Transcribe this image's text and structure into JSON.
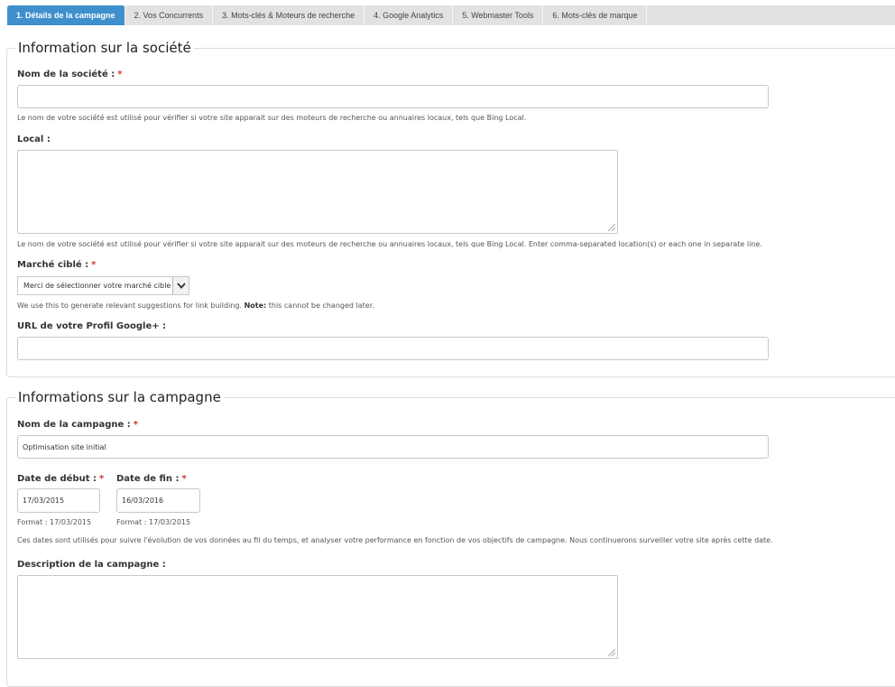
{
  "tabs": [
    {
      "label": "1. Détails de la campagne",
      "active": true
    },
    {
      "label": "2. Vos Concurrents"
    },
    {
      "label": "3. Mots-clés & Moteurs de recherche"
    },
    {
      "label": "4. Google Analytics"
    },
    {
      "label": "5. Webmaster Tools"
    },
    {
      "label": "6. Mots-clés de marque"
    }
  ],
  "company_section": {
    "legend": "Information sur la société",
    "company_name": {
      "label": "Nom de la société :",
      "required": "*",
      "value": "",
      "help": "Le nom de votre société est utilisé pour vérifier si votre site apparait sur des moteurs de recherche ou annuaires locaux, tels que Bing Local."
    },
    "local": {
      "label": "Local :",
      "value": "",
      "help": "Le nom de votre société est utilisé pour vérifier si votre site apparait sur des moteurs de recherche ou annuaires locaux, tels que Bing Local. Enter comma-separated location(s) or each one in separate line."
    },
    "market": {
      "label": "Marché ciblé :",
      "required": "*",
      "selected": "Merci de sélectionner votre marché cible",
      "help_prefix": "We use this to generate relevant suggestions for link building.",
      "help_note_label": "Note:",
      "help_note": "this cannot be changed later."
    },
    "google_plus": {
      "label": "URL de votre Profil Google+ :",
      "value": ""
    }
  },
  "campaign_section": {
    "legend": "Informations sur la campagne",
    "campaign_name": {
      "label": "Nom de la campagne :",
      "required": "*",
      "value": "Optimisation site initial"
    },
    "start_date": {
      "label": "Date de début :",
      "required": "*",
      "value": "17/03/2015",
      "format": "Format : 17/03/2015"
    },
    "end_date": {
      "label": "Date de fin :",
      "required": "*",
      "value": "16/03/2016",
      "format": "Format : 17/03/2015"
    },
    "dates_help": "Ces dates sont utilisés pour suivre l'évolution de vos données au fil du temps, et analyser votre performance en fonction de vos objectifs de campagne. Nous continuerons surveiller votre site après cette date.",
    "description": {
      "label": "Description de la campagne :",
      "value": ""
    }
  }
}
